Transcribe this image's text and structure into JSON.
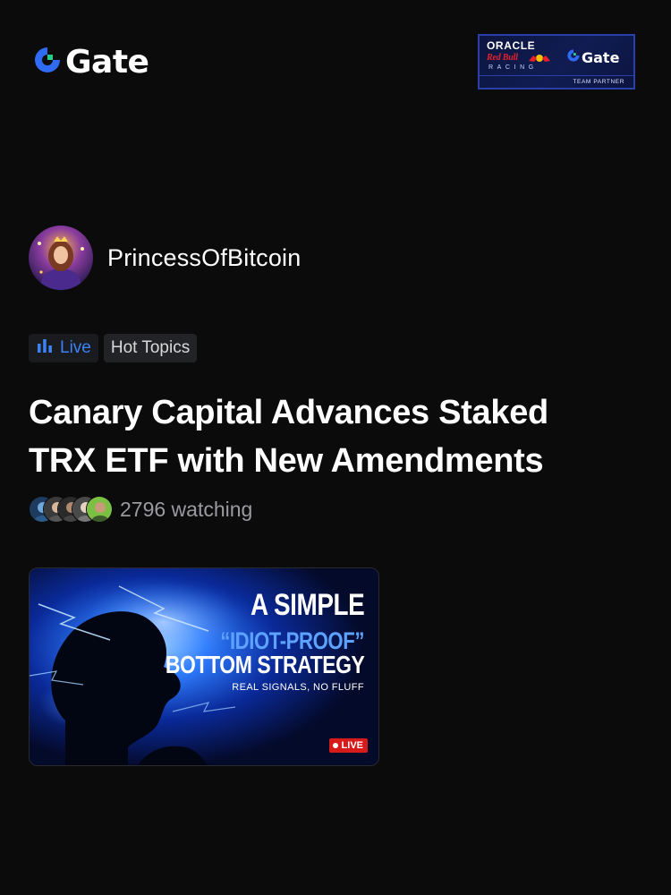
{
  "header": {
    "logo_text": "Gate",
    "partner_badge": {
      "oracle": "ORACLE",
      "red_bull": "Red Bull",
      "racing": "RACING",
      "gate": "Gate",
      "team_partner": "TEAM PARTNER"
    }
  },
  "author": {
    "name": "PrincessOfBitcoin"
  },
  "tags": {
    "live_label": "Live",
    "topic_label": "Hot Topics"
  },
  "post": {
    "title_line1": "Canary Capital Advances Staked",
    "title_line2": "TRX ETF with New Amendments"
  },
  "watching": {
    "count_text": "2796 watching"
  },
  "thumbnail": {
    "line1": "A SIMPLE",
    "line2": "“IDIOT-PROOF”",
    "line3": "BOTTOM STRATEGY",
    "line4": "REAL SIGNALS, NO FLUFF",
    "live_badge": "LIVE"
  },
  "colors": {
    "background": "#0b0b0c",
    "accent_blue": "#3b82f6",
    "gate_green": "#1fd18a",
    "live_red": "#d71a1a"
  },
  "icons": {
    "gate_logo": "gate-logo-icon",
    "live_bars": "bar-chart-icon"
  }
}
